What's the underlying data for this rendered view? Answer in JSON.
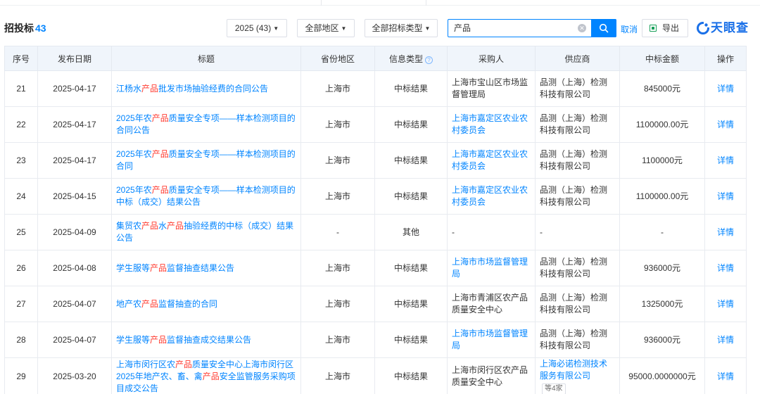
{
  "header": {
    "title": "招投标",
    "count": "43",
    "filters": {
      "year": "2025 (43)",
      "region": "全部地区",
      "type": "全部招标类型"
    },
    "search": {
      "value": "产品"
    },
    "cancel_label": "取消",
    "export_label": "导出",
    "brand": "天眼查"
  },
  "columns": [
    "序号",
    "发布日期",
    "标题",
    "省份地区",
    "信息类型",
    "采购人",
    "供应商",
    "中标金额",
    "操作"
  ],
  "rows": [
    {
      "no": "21",
      "date": "2025-04-17",
      "title": [
        [
          "江杨水",
          false
        ],
        [
          "产品",
          true
        ],
        [
          "批发市场抽验经费的合同公告",
          false
        ]
      ],
      "region": "上海市",
      "type": "中标结果",
      "buyer": "上海市宝山区市场监督管理局",
      "buyer_link": false,
      "supplier": "品测（上海）检测科技有限公司",
      "supplier_link": false,
      "amount": "845000元",
      "action": "详情"
    },
    {
      "no": "22",
      "date": "2025-04-17",
      "title": [
        [
          "2025年农",
          false
        ],
        [
          "产品",
          true
        ],
        [
          "质量安全专项——样本检测项目的合同公告",
          false
        ]
      ],
      "region": "上海市",
      "type": "中标结果",
      "buyer": "上海市嘉定区农业农村委员会",
      "buyer_link": true,
      "supplier": "品测（上海）检测科技有限公司",
      "supplier_link": false,
      "amount": "1100000.00元",
      "action": "详情"
    },
    {
      "no": "23",
      "date": "2025-04-17",
      "title": [
        [
          "2025年农",
          false
        ],
        [
          "产品",
          true
        ],
        [
          "质量安全专项——样本检测项目的合同",
          false
        ]
      ],
      "region": "上海市",
      "type": "中标结果",
      "buyer": "上海市嘉定区农业农村委员会",
      "buyer_link": true,
      "supplier": "品测（上海）检测科技有限公司",
      "supplier_link": false,
      "amount": "1100000元",
      "action": "详情"
    },
    {
      "no": "24",
      "date": "2025-04-15",
      "title": [
        [
          "2025年农",
          false
        ],
        [
          "产品",
          true
        ],
        [
          "质量安全专项——样本检测项目的中标（成交）结果公告",
          false
        ]
      ],
      "region": "上海市",
      "type": "中标结果",
      "buyer": "上海市嘉定区农业农村委员会",
      "buyer_link": true,
      "supplier": "品测（上海）检测科技有限公司",
      "supplier_link": false,
      "amount": "1100000.00元",
      "action": "详情"
    },
    {
      "no": "25",
      "date": "2025-04-09",
      "title": [
        [
          "集贸农",
          false
        ],
        [
          "产品",
          true
        ],
        [
          "水",
          false
        ],
        [
          "产品",
          true
        ],
        [
          "抽验经费的中标（成交）结果公告",
          false
        ]
      ],
      "region": "-",
      "type": "其他",
      "buyer": "-",
      "buyer_link": false,
      "supplier": "-",
      "supplier_link": false,
      "amount": "-",
      "action": "详情"
    },
    {
      "no": "26",
      "date": "2025-04-08",
      "title": [
        [
          "学生服等",
          false
        ],
        [
          "产品",
          true
        ],
        [
          "监督抽查结果公告",
          false
        ]
      ],
      "region": "上海市",
      "type": "中标结果",
      "buyer": "上海市市场监督管理局",
      "buyer_link": true,
      "supplier": "品测（上海）检测科技有限公司",
      "supplier_link": false,
      "amount": "936000元",
      "action": "详情"
    },
    {
      "no": "27",
      "date": "2025-04-07",
      "title": [
        [
          "地产农",
          false
        ],
        [
          "产品",
          true
        ],
        [
          "监督抽查的合同",
          false
        ]
      ],
      "region": "上海市",
      "type": "中标结果",
      "buyer": "上海市青浦区农产品质量安全中心",
      "buyer_link": false,
      "supplier": "品测（上海）检测科技有限公司",
      "supplier_link": false,
      "amount": "1325000元",
      "action": "详情"
    },
    {
      "no": "28",
      "date": "2025-04-07",
      "title": [
        [
          "学生服等",
          false
        ],
        [
          "产品",
          true
        ],
        [
          "监督抽查成交结果公告",
          false
        ]
      ],
      "region": "上海市",
      "type": "中标结果",
      "buyer": "上海市市场监督管理局",
      "buyer_link": true,
      "supplier": "品测（上海）检测科技有限公司",
      "supplier_link": false,
      "amount": "936000元",
      "action": "详情"
    },
    {
      "no": "29",
      "date": "2025-03-20",
      "title": [
        [
          "上海市闵行区农",
          false
        ],
        [
          "产品",
          true
        ],
        [
          "质量安全中心上海市闵行区2025年地产农、畜、禽",
          false
        ],
        [
          "产品",
          true
        ],
        [
          "安全监管服务采购项目成交公告",
          false
        ]
      ],
      "region": "上海市",
      "type": "中标结果",
      "buyer": "上海市闵行区农产品质量安全中心",
      "buyer_link": false,
      "supplier": "上海必诺检测技术服务有限公司",
      "supplier_link": true,
      "supplier_more": "等4家",
      "amount": "95000.0000000元",
      "action": "详情"
    }
  ]
}
